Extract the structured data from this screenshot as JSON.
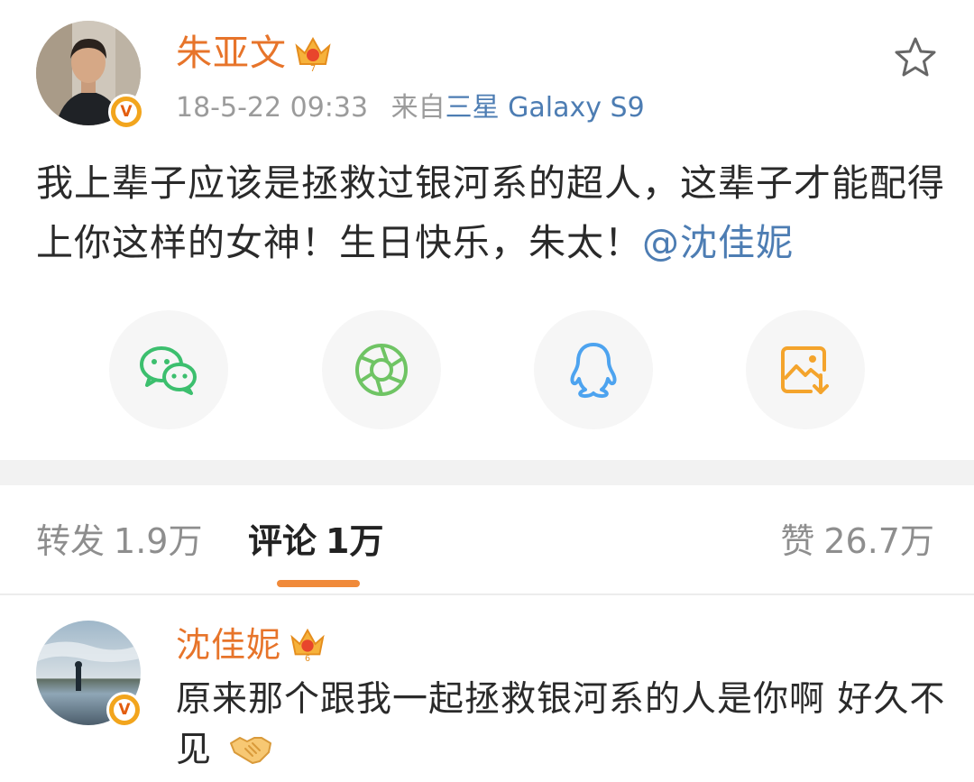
{
  "post": {
    "author": "朱亚文",
    "crown_level": "7",
    "verified_glyph": "V",
    "time": "18-5-22 09:33",
    "source_prefix": "来自",
    "source": "三星 Galaxy S9",
    "text": "我上辈子应该是拯救过银河系的超人，这辈子才能配得上你这样的女神！生日快乐，朱太！",
    "mention": "@沈佳妮"
  },
  "share": {
    "icons": [
      "wechat-icon",
      "moments-icon",
      "qq-icon",
      "save-image-icon"
    ]
  },
  "tabs": {
    "repost_label": "转发",
    "repost_count": "1.9万",
    "comments_label": "评论",
    "comments_count": "1万",
    "likes_label": "赞",
    "likes_count": "26.7万"
  },
  "comment": {
    "author": "沈佳妮",
    "crown_level": "6",
    "verified_glyph": "V",
    "text": "原来那个跟我一起拯救银河系的人是你啊 好久不见",
    "emoji": "handshake-icon"
  },
  "colors": {
    "name_orange": "#e7742a",
    "link_blue": "#4d7db3",
    "tab_indicator": "#f08a3a",
    "wechat_green": "#3cbf6e",
    "moments_green": "#6fc464",
    "qq_blue": "#4da3ef",
    "save_orange": "#f4a42c"
  }
}
